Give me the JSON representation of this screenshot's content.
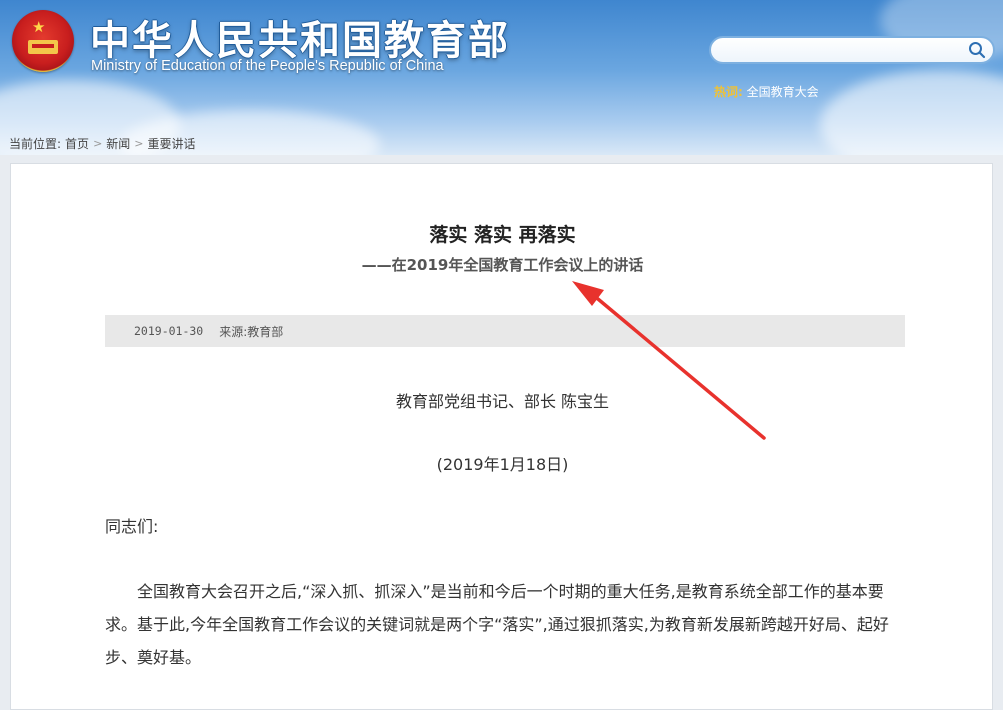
{
  "header": {
    "title_cn": "中华人民共和国教育部",
    "title_en": "Ministry of Education of the People's Republic of China",
    "search": {
      "placeholder": "",
      "value": ""
    },
    "hot": {
      "label": "热词:",
      "link": "全国教育大会"
    }
  },
  "breadcrumb": {
    "prefix": "当前位置:",
    "items": [
      "首页",
      "新闻",
      "重要讲话"
    ]
  },
  "article": {
    "title": "落实 落实 再落实",
    "subtitle": "——在2019年全国教育工作会议上的讲话",
    "date": "2019-01-30",
    "source": "来源:教育部",
    "author": "教育部党组书记、部长 陈宝生",
    "speech_date": "(2019年1月18日)",
    "greeting": "同志们:",
    "paragraphs": [
      "全国教育大会召开之后,“深入抓、抓深入”是当前和今后一个时期的重大任务,是教育系统全部工作的基本要求。基于此,今年全国教育工作会议的关键词就是两个字“落实”,通过狠抓落实,为教育新发展新跨越开好局、起好步、奠好基。"
    ]
  },
  "annotation": {
    "arrow_color": "#e8322d"
  },
  "colors": {
    "header_blue": "#3f86cf",
    "hot_label": "#f0c235",
    "meta_bg": "#e8e8e8"
  }
}
